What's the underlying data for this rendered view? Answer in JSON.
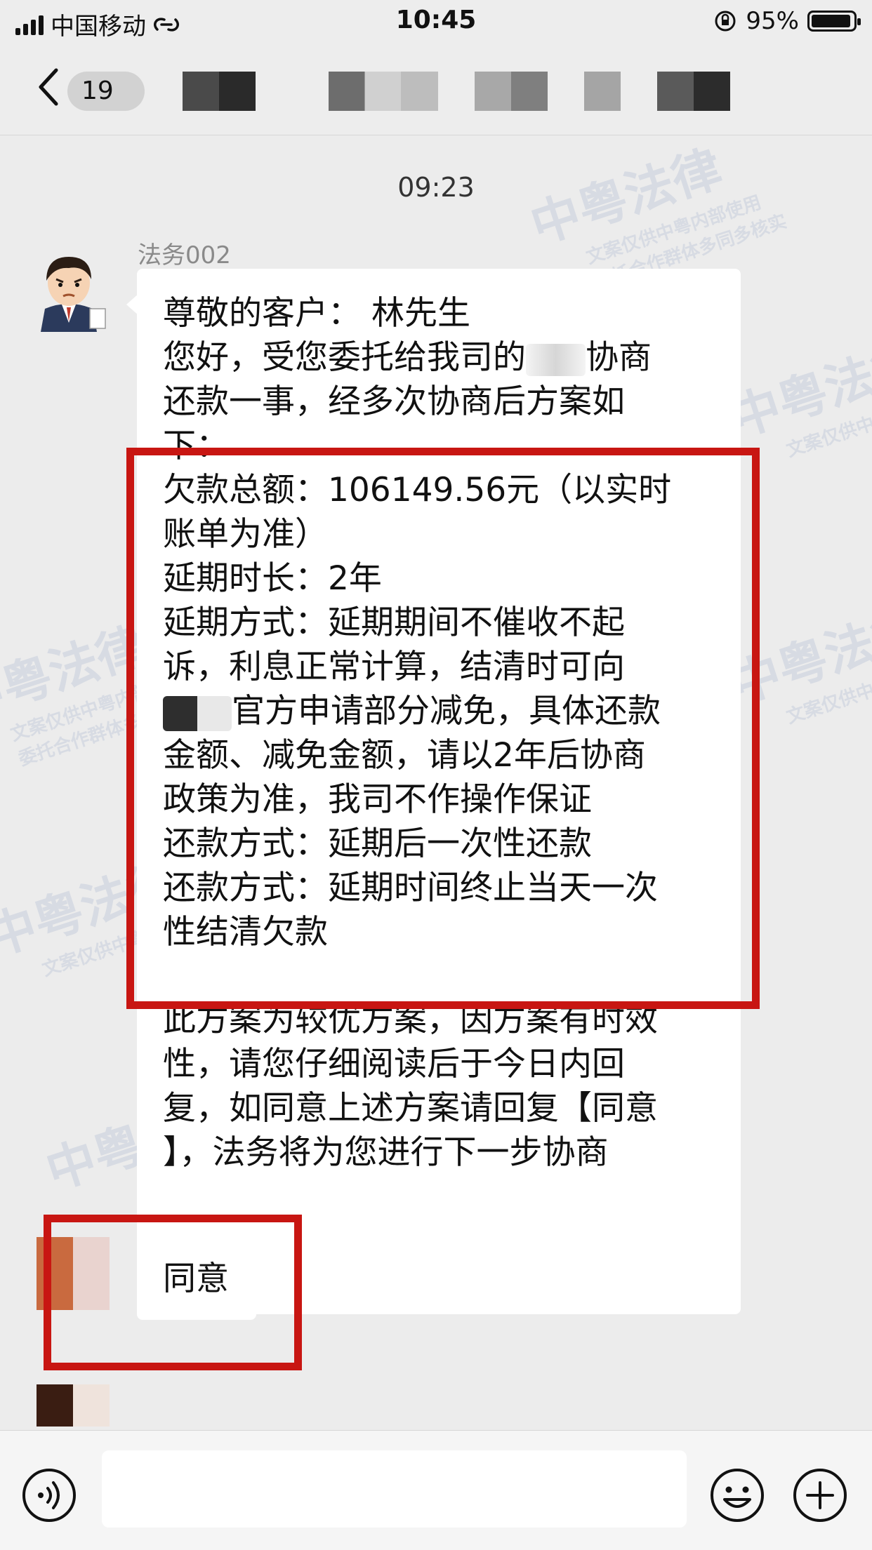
{
  "status_bar": {
    "carrier": "中国移动",
    "time": "10:45",
    "battery_percent_label": "95%",
    "battery_level": 0.95
  },
  "nav": {
    "unread_count": "19",
    "icons": [
      "back-icon"
    ]
  },
  "chat": {
    "timestamp": "09:23",
    "sender_name": "法务002",
    "message_intro": [
      "尊敬的客户： 林先生",
      "您好，受您委托给我司的",
      "协商",
      "还款一事，经多次协商后方案如",
      "下："
    ],
    "message_plan": [
      "欠款总额：106149.56元（以实时",
      "账单为准）",
      "延期时长：2年",
      "延期方式：延期期间不催收不起",
      "诉，利息正常计算，结清时可向",
      "官方申请部分减免，具体还款",
      "金额、减免金额，请以2年后协商",
      "政策为准，我司不作操作保证",
      "还款方式：延期后一次性还款",
      "还款方式：延期时间终止当天一次",
      "性结清欠款"
    ],
    "message_outro": [
      "此方案为较优方案，因方案有时效",
      "性，请您仔细阅读后于今日内回",
      "复，如同意上述方案请回复【同意",
      "】，法务将为您进行下一步协商"
    ],
    "reply_text": "同意",
    "watermark": {
      "title": "中粤法律",
      "line1": "文案仅供中粤内部使用",
      "line2": "委托合作群体多同多核实"
    },
    "highlight_color": "#c81612"
  },
  "input_bar": {
    "input_value": "",
    "icons": [
      "voice-icon",
      "emoji-icon",
      "plus-icon"
    ]
  }
}
